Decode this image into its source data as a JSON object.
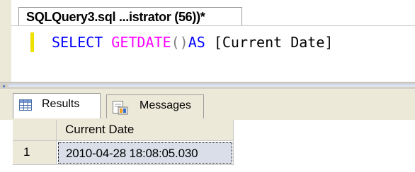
{
  "editor_tab": {
    "title": "SQLQuery3.sql ...istrator (56))*"
  },
  "query": {
    "select_kw": "SELECT",
    "func": "GETDATE",
    "parens": "()",
    "as_kw": "AS",
    "alias": "[Current Date]"
  },
  "results_tabs": [
    {
      "label": "Results",
      "icon": "grid-icon",
      "active": true
    },
    {
      "label": "Messages",
      "icon": "messages-icon",
      "active": false
    }
  ],
  "grid": {
    "columns": [
      "Current Date"
    ],
    "rows": [
      {
        "num": "1",
        "values": [
          "2010-04-28 18:08:05.030"
        ]
      }
    ]
  },
  "colors": {
    "keyword": "#0000ff",
    "function": "#ff00ff",
    "operator": "#808080",
    "change_bar": "#f0e000",
    "selected_cell": "#d9dee8"
  }
}
